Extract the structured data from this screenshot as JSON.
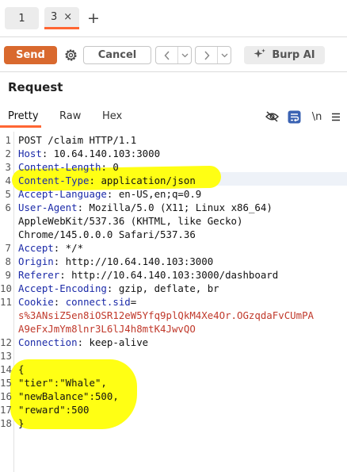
{
  "tabs": [
    {
      "label": "1",
      "active": false
    },
    {
      "label": "3",
      "active": true
    }
  ],
  "tab_close_glyph": "×",
  "tab_add_glyph": "+",
  "toolbar": {
    "send_label": "Send",
    "cancel_label": "Cancel",
    "burp_ai_label": "Burp AI",
    "send_color": "#d9692e"
  },
  "panel": {
    "title": "Request",
    "subtabs": [
      "Pretty",
      "Raw",
      "Hex"
    ],
    "active_subtab": "Pretty",
    "newline_toggle_label": "\\n"
  },
  "request_lines": [
    {
      "n": "1",
      "parts": [
        {
          "t": "POST /claim HTTP/1.1",
          "k": "plain"
        }
      ]
    },
    {
      "n": "2",
      "parts": [
        {
          "t": "Host",
          "k": "name"
        },
        {
          "t": ": 10.64.140.103:3000",
          "k": "plain"
        }
      ]
    },
    {
      "n": "3",
      "parts": [
        {
          "t": "Content-Length",
          "k": "name"
        },
        {
          "t": ": 0",
          "k": "plain"
        }
      ]
    },
    {
      "n": "4",
      "parts": [
        {
          "t": "Content-Type",
          "k": "name"
        },
        {
          "t": ": application/json",
          "k": "plain"
        }
      ]
    },
    {
      "n": "5",
      "parts": [
        {
          "t": "Accept-Language",
          "k": "name"
        },
        {
          "t": ": en-US,en;q=0.9",
          "k": "plain"
        }
      ]
    },
    {
      "n": "6",
      "parts": [
        {
          "t": "User-Agent",
          "k": "name"
        },
        {
          "t": ": Mozilla/5.0 (X11; Linux x86_64)",
          "k": "plain"
        }
      ]
    },
    {
      "n": "",
      "parts": [
        {
          "t": "AppleWebKit/537.36 (KHTML, like Gecko)",
          "k": "plain"
        }
      ]
    },
    {
      "n": "",
      "parts": [
        {
          "t": "Chrome/145.0.0.0 Safari/537.36",
          "k": "plain"
        }
      ]
    },
    {
      "n": "7",
      "parts": [
        {
          "t": "Accept",
          "k": "name"
        },
        {
          "t": ": */*",
          "k": "plain"
        }
      ]
    },
    {
      "n": "8",
      "parts": [
        {
          "t": "Origin",
          "k": "name"
        },
        {
          "t": ": http://10.64.140.103:3000",
          "k": "plain"
        }
      ]
    },
    {
      "n": "9",
      "parts": [
        {
          "t": "Referer",
          "k": "name"
        },
        {
          "t": ": http://10.64.140.103:3000/dashboard",
          "k": "plain"
        }
      ]
    },
    {
      "n": "10",
      "parts": [
        {
          "t": "Accept-Encoding",
          "k": "name"
        },
        {
          "t": ": gzip, deflate, br",
          "k": "plain"
        }
      ]
    },
    {
      "n": "11",
      "parts": [
        {
          "t": "Cookie",
          "k": "name"
        },
        {
          "t": ": ",
          "k": "plain"
        },
        {
          "t": "connect.sid",
          "k": "name"
        },
        {
          "t": "=",
          "k": "plain"
        }
      ]
    },
    {
      "n": "",
      "parts": [
        {
          "t": "s%3ANsiZ5en8iOSR12eW5Yfq9plQkM4Xe4Or.OGzqdaFvCUmPA",
          "k": "cookie"
        }
      ]
    },
    {
      "n": "",
      "parts": [
        {
          "t": "A9eFxJmYm8lnr3L6lJ4h8mtK4JwvQO",
          "k": "cookie"
        }
      ]
    },
    {
      "n": "12",
      "parts": [
        {
          "t": "Connection",
          "k": "name"
        },
        {
          "t": ": keep-alive",
          "k": "plain"
        }
      ]
    },
    {
      "n": "13",
      "parts": []
    },
    {
      "n": "14",
      "parts": [
        {
          "t": "{",
          "k": "plain"
        }
      ]
    },
    {
      "n": "15",
      "parts": [
        {
          "t": "\"tier\":\"Whale\",",
          "k": "plain"
        }
      ]
    },
    {
      "n": "16",
      "parts": [
        {
          "t": "\"newBalance\":500,",
          "k": "plain"
        }
      ]
    },
    {
      "n": "17",
      "parts": [
        {
          "t": "\"reward\":500",
          "k": "plain"
        }
      ]
    },
    {
      "n": "18",
      "parts": [
        {
          "t": "}",
          "k": "plain"
        }
      ]
    }
  ],
  "colors": {
    "accent": "#ff6633",
    "header_name": "#1b2aa8",
    "cookie_value": "#c0392b",
    "highlighter": "#ffff14"
  }
}
